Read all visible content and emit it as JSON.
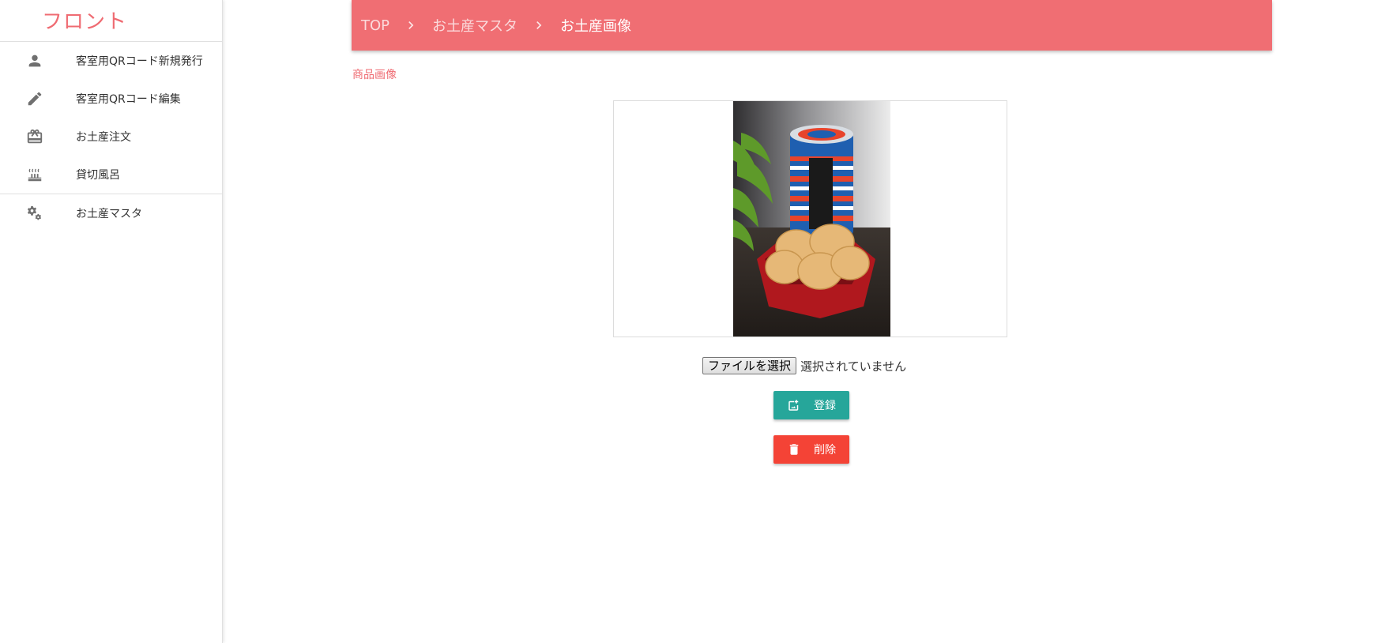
{
  "sidebar": {
    "brand": "フロント",
    "items": [
      {
        "label": "客室用QRコード新規発行",
        "icon": "person-icon"
      },
      {
        "label": "客室用QRコード編集",
        "icon": "pencil-icon"
      },
      {
        "label": "お土産注文",
        "icon": "gift-card-icon"
      },
      {
        "label": "貸切風呂",
        "icon": "hot-bath-icon"
      },
      {
        "label": "お土産マスタ",
        "icon": "gears-icon"
      }
    ]
  },
  "breadcrumb": {
    "items": [
      "TOP",
      "お土産マスタ",
      "お土産画像"
    ]
  },
  "main": {
    "section_label": "商品画像",
    "file": {
      "button_label": "ファイルを選択",
      "status": "選択されていません"
    },
    "register_label": "登録",
    "delete_label": "削除"
  },
  "colors": {
    "accent": "#f06e73",
    "register": "#26a69a",
    "delete": "#f44336"
  }
}
